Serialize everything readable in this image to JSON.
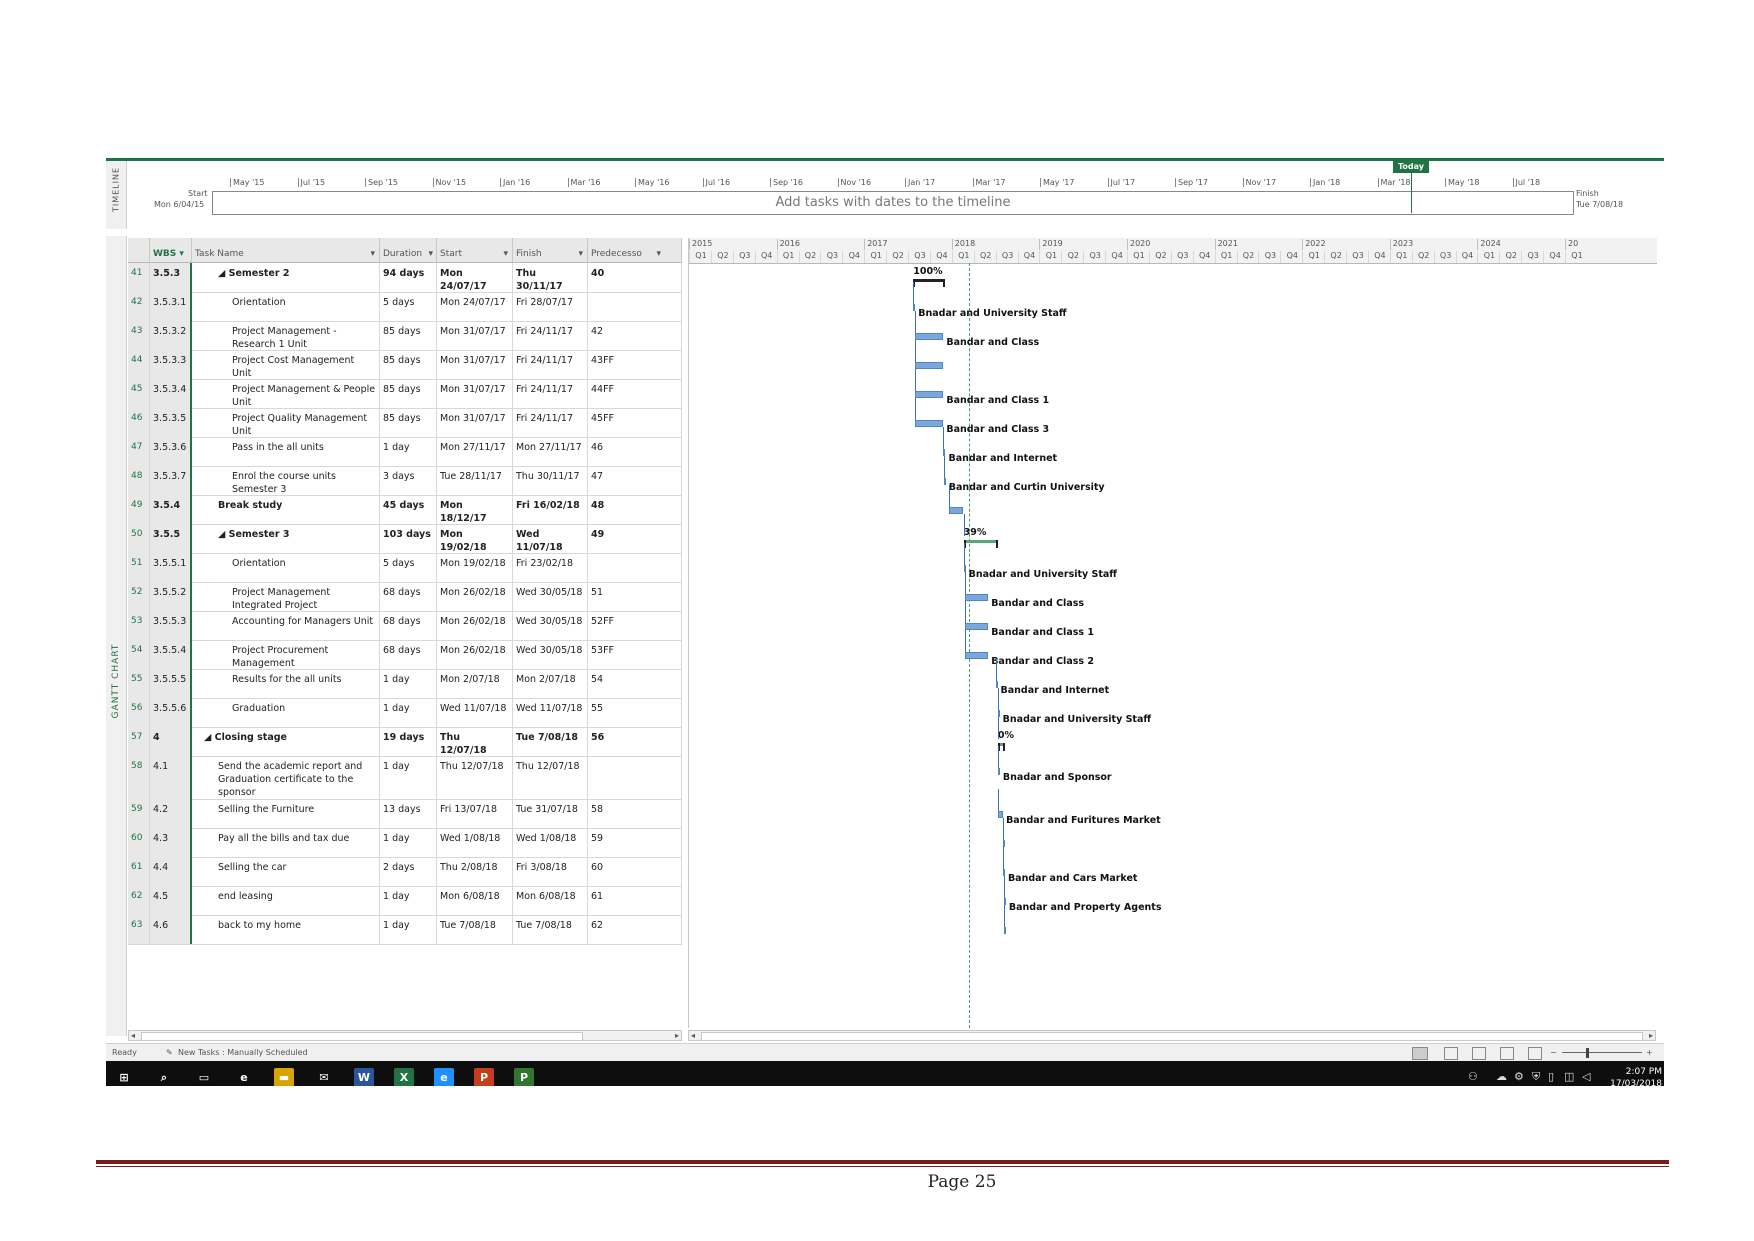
{
  "timeline": {
    "side_label": "TIMELINE",
    "ticks": [
      "May '15",
      "Jul '15",
      "Sep '15",
      "Nov '15",
      "Jan '16",
      "Mar '16",
      "May '16",
      "Jul '16",
      "Sep '16",
      "Nov '16",
      "Jan '17",
      "Mar '17",
      "May '17",
      "Jul '17",
      "Sep '17",
      "Nov '17",
      "Jan '18",
      "Mar '18",
      "May '18",
      "Jul '18"
    ],
    "start_label": "Start",
    "start_date": "Mon 6/04/15",
    "finish_label": "Finish",
    "finish_date": "Tue 7/08/18",
    "placeholder": "Add tasks with dates to the timeline",
    "today": "Today"
  },
  "gantt_label": "GANTT CHART",
  "columns": {
    "wbs": "WBS",
    "task_name": "Task Name",
    "duration": "Duration",
    "start": "Start",
    "finish": "Finish",
    "predecessors": "Predecesso"
  },
  "chart_header": {
    "years": [
      "2015",
      "2016",
      "2017",
      "2018",
      "2019",
      "2020",
      "2021",
      "2022",
      "2023",
      "2024",
      "20"
    ],
    "quarters": [
      "Q1",
      "Q2",
      "Q3",
      "Q4"
    ]
  },
  "rows": [
    {
      "id": "41",
      "wbs": "3.5.3",
      "name": "◢ Semester 2",
      "duration": "94 days",
      "start": "Mon 24/07/17",
      "finish": "Thu 30/11/17",
      "pred": "40",
      "bold": true,
      "indent": 1,
      "resource": "100%"
    },
    {
      "id": "42",
      "wbs": "3.5.3.1",
      "name": "Orientation",
      "duration": "5 days",
      "start": "Mon 24/07/17",
      "finish": "Fri 28/07/17",
      "pred": "",
      "bold": false,
      "indent": 2,
      "resource": "Bnadar and University Staff"
    },
    {
      "id": "43",
      "wbs": "3.5.3.2",
      "name": "Project Management - Research 1 Unit",
      "duration": "85 days",
      "start": "Mon 31/07/17",
      "finish": "Fri 24/11/17",
      "pred": "42",
      "bold": false,
      "indent": 2,
      "resource": "Bandar and Class"
    },
    {
      "id": "44",
      "wbs": "3.5.3.3",
      "name": "Project Cost Management Unit",
      "duration": "85 days",
      "start": "Mon 31/07/17",
      "finish": "Fri 24/11/17",
      "pred": "43FF",
      "bold": false,
      "indent": 2,
      "resource": ""
    },
    {
      "id": "45",
      "wbs": "3.5.3.4",
      "name": "Project Management & People Unit",
      "duration": "85 days",
      "start": "Mon 31/07/17",
      "finish": "Fri 24/11/17",
      "pred": "44FF",
      "bold": false,
      "indent": 2,
      "resource": "Bandar and Class 1"
    },
    {
      "id": "46",
      "wbs": "3.5.3.5",
      "name": "Project Quality Management Unit",
      "duration": "85 days",
      "start": "Mon 31/07/17",
      "finish": "Fri 24/11/17",
      "pred": "45FF",
      "bold": false,
      "indent": 2,
      "resource": "Bandar and Class 3"
    },
    {
      "id": "47",
      "wbs": "3.5.3.6",
      "name": "Pass in the all units",
      "duration": "1 day",
      "start": "Mon 27/11/17",
      "finish": "Mon 27/11/17",
      "pred": "46",
      "bold": false,
      "indent": 2,
      "resource": "Bandar and Internet"
    },
    {
      "id": "48",
      "wbs": "3.5.3.7",
      "name": "Enrol the course units Semester 3",
      "duration": "3 days",
      "start": "Tue 28/11/17",
      "finish": "Thu 30/11/17",
      "pred": "47",
      "bold": false,
      "indent": 2,
      "resource": "Bandar and Curtin University"
    },
    {
      "id": "49",
      "wbs": "3.5.4",
      "name": "Break study",
      "duration": "45 days",
      "start": "Mon 18/12/17",
      "finish": "Fri 16/02/18",
      "pred": "48",
      "bold": true,
      "indent": 1,
      "resource": ""
    },
    {
      "id": "50",
      "wbs": "3.5.5",
      "name": "◢ Semester 3",
      "duration": "103 days",
      "start": "Mon 19/02/18",
      "finish": "Wed 11/07/18",
      "pred": "49",
      "bold": true,
      "indent": 1,
      "resource": "39%"
    },
    {
      "id": "51",
      "wbs": "3.5.5.1",
      "name": "Orientation",
      "duration": "5 days",
      "start": "Mon 19/02/18",
      "finish": "Fri 23/02/18",
      "pred": "",
      "bold": false,
      "indent": 2,
      "resource": "Bnadar and University Staff"
    },
    {
      "id": "52",
      "wbs": "3.5.5.2",
      "name": "Project Management Integrated Project",
      "duration": "68 days",
      "start": "Mon 26/02/18",
      "finish": "Wed 30/05/18",
      "pred": "51",
      "bold": false,
      "indent": 2,
      "resource": "Bandar and Class"
    },
    {
      "id": "53",
      "wbs": "3.5.5.3",
      "name": "Accounting for Managers Unit",
      "duration": "68 days",
      "start": "Mon 26/02/18",
      "finish": "Wed 30/05/18",
      "pred": "52FF",
      "bold": false,
      "indent": 2,
      "resource": "Bandar and Class 1"
    },
    {
      "id": "54",
      "wbs": "3.5.5.4",
      "name": "Project Procurement Management",
      "duration": "68 days",
      "start": "Mon 26/02/18",
      "finish": "Wed 30/05/18",
      "pred": "53FF",
      "bold": false,
      "indent": 2,
      "resource": "Bandar and Class 2"
    },
    {
      "id": "55",
      "wbs": "3.5.5.5",
      "name": "Results for the all units",
      "duration": "1 day",
      "start": "Mon 2/07/18",
      "finish": "Mon 2/07/18",
      "pred": "54",
      "bold": false,
      "indent": 2,
      "resource": "Bandar and Internet"
    },
    {
      "id": "56",
      "wbs": "3.5.5.6",
      "name": "Graduation",
      "duration": "1 day",
      "start": "Wed 11/07/18",
      "finish": "Wed 11/07/18",
      "pred": "55",
      "bold": false,
      "indent": 2,
      "resource": "Bnadar and University Staff"
    },
    {
      "id": "57",
      "wbs": "4",
      "name": "◢ Closing stage",
      "duration": "19 days",
      "start": "Thu 12/07/18",
      "finish": "Tue 7/08/18",
      "pred": "56",
      "bold": true,
      "indent": 0,
      "resource": "0%"
    },
    {
      "id": "58",
      "wbs": "4.1",
      "name": "Send the academic report and Graduation certificate to the sponsor",
      "duration": "1 day",
      "start": "Thu 12/07/18",
      "finish": "Thu 12/07/18",
      "pred": "",
      "bold": false,
      "indent": 1,
      "resource": "Bnadar and Sponsor"
    },
    {
      "id": "59",
      "wbs": "4.2",
      "name": "Selling the Furniture",
      "duration": "13 days",
      "start": "Fri 13/07/18",
      "finish": "Tue 31/07/18",
      "pred": "58",
      "bold": false,
      "indent": 1,
      "resource": "Bandar and Furitures Market"
    },
    {
      "id": "60",
      "wbs": "4.3",
      "name": "Pay all the bills and tax due",
      "duration": "1 day",
      "start": "Wed 1/08/18",
      "finish": "Wed 1/08/18",
      "pred": "59",
      "bold": false,
      "indent": 1,
      "resource": ""
    },
    {
      "id": "61",
      "wbs": "4.4",
      "name": "Selling the car",
      "duration": "2 days",
      "start": "Thu 2/08/18",
      "finish": "Fri 3/08/18",
      "pred": "60",
      "bold": false,
      "indent": 1,
      "resource": "Bandar and Cars Market"
    },
    {
      "id": "62",
      "wbs": "4.5",
      "name": "end leasing",
      "duration": "1 day",
      "start": "Mon 6/08/18",
      "finish": "Mon 6/08/18",
      "pred": "61",
      "bold": false,
      "indent": 1,
      "resource": "Bandar and Property Agents"
    },
    {
      "id": "63",
      "wbs": "4.6",
      "name": "back to my home",
      "duration": "1 day",
      "start": "Tue 7/08/18",
      "finish": "Tue 7/08/18",
      "pred": "62",
      "bold": false,
      "indent": 1,
      "resource": ""
    }
  ],
  "status": {
    "ready": "Ready",
    "new_tasks": "New Tasks : Manually Scheduled"
  },
  "taskbar": {
    "apps": [
      "start-icon",
      "search-icon",
      "task-view-icon",
      "edge-icon",
      "file-explorer-icon",
      "mail-icon",
      "word-icon",
      "excel-icon",
      "ie-icon",
      "powerpoint-icon",
      "project-icon"
    ],
    "time": "2:07 PM",
    "date": "17/03/2018"
  },
  "footer": {
    "page": "Page 25"
  },
  "colors": {
    "accent": "#217346",
    "bar": "#7ba7dd",
    "footer_rule": "#7b1a1a"
  }
}
